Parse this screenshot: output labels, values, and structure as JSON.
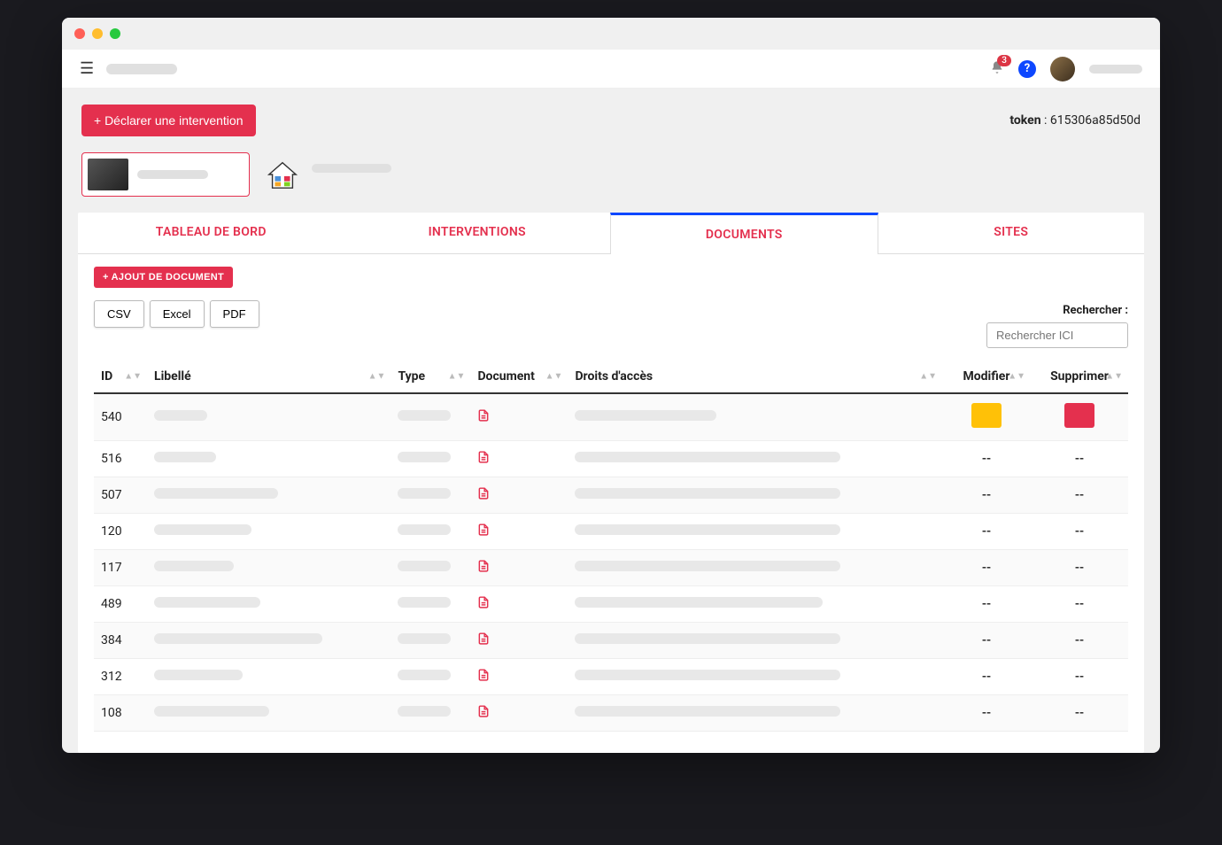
{
  "header": {
    "notif_count": "3"
  },
  "topbar": {
    "declare_label": "+ Déclarer une intervention",
    "token_label": "token",
    "token_value": "615306a85d50d"
  },
  "tabs": [
    {
      "label": "TABLEAU DE BORD"
    },
    {
      "label": "INTERVENTIONS"
    },
    {
      "label": "DOCUMENTS"
    },
    {
      "label": "SITES"
    }
  ],
  "toolbar": {
    "add_label": "+ AJOUT DE DOCUMENT",
    "csv": "CSV",
    "excel": "Excel",
    "pdf": "PDF",
    "search_label": "Rechercher :",
    "search_placeholder": "Rechercher ICI"
  },
  "columns": {
    "id": "ID",
    "libelle": "Libellé",
    "type": "Type",
    "document": "Document",
    "droits": "Droits d'accès",
    "modifier": "Modifier",
    "supprimer": "Supprimer"
  },
  "rows": [
    {
      "id": "540",
      "lib_w": 60,
      "type_w": 60,
      "droits_w": 160,
      "editable": true
    },
    {
      "id": "516",
      "lib_w": 70,
      "type_w": 60,
      "droits_w": 300,
      "editable": false
    },
    {
      "id": "507",
      "lib_w": 140,
      "type_w": 60,
      "droits_w": 300,
      "editable": false
    },
    {
      "id": "120",
      "lib_w": 110,
      "type_w": 60,
      "droits_w": 300,
      "editable": false
    },
    {
      "id": "117",
      "lib_w": 90,
      "type_w": 60,
      "droits_w": 300,
      "editable": false
    },
    {
      "id": "489",
      "lib_w": 120,
      "type_w": 60,
      "droits_w": 280,
      "editable": false
    },
    {
      "id": "384",
      "lib_w": 190,
      "type_w": 60,
      "droits_w": 300,
      "editable": false
    },
    {
      "id": "312",
      "lib_w": 100,
      "type_w": 60,
      "droits_w": 300,
      "editable": false
    },
    {
      "id": "108",
      "lib_w": 130,
      "type_w": 60,
      "droits_w": 300,
      "editable": false
    }
  ],
  "dash": "--"
}
